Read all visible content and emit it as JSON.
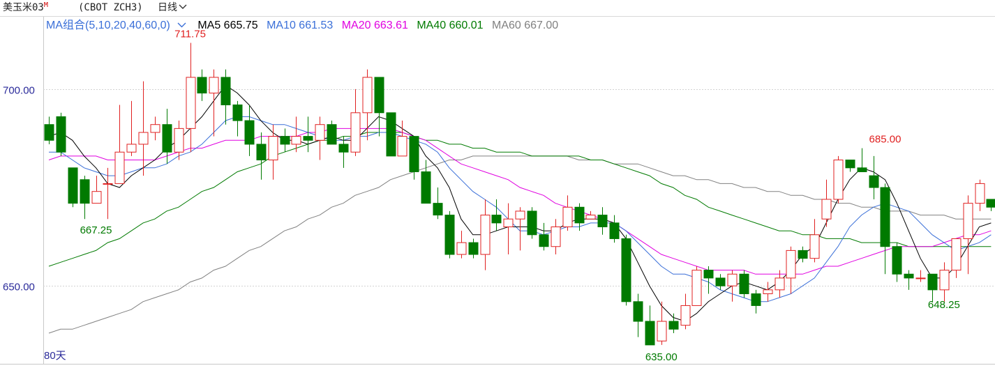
{
  "header": {
    "instrument": "美玉米03",
    "marker": "M",
    "code": "(CBOT ZCH3)",
    "period": "日线",
    "period_icon": "chevron-down-icon"
  },
  "ma_legend": {
    "group_label": "MA组合(5,10,20,40,60,0)",
    "group_icon": "chevron-down-icon",
    "items": [
      {
        "label": "MA5 665.75",
        "color": "#000000"
      },
      {
        "label": "MA10 661.53",
        "color": "#3a6fd8"
      },
      {
        "label": "MA20 663.61",
        "color": "#e000e0"
      },
      {
        "label": "MA40 660.01",
        "color": "#007a00"
      },
      {
        "label": "MA60 667.00",
        "color": "#808080"
      }
    ]
  },
  "colors": {
    "up": "#e02020",
    "down": "#007a00",
    "ma5": "#000000",
    "ma10": "#3a6fd8",
    "ma20": "#e000e0",
    "ma40": "#007a00",
    "ma60": "#808080",
    "axis": "#c8c8c8"
  },
  "chart_data": {
    "type": "candlestick",
    "period_label": "80天",
    "y_axis": {
      "ticks": [
        650.0,
        700.0
      ],
      "tick_labels": [
        "650.00",
        "700.00"
      ],
      "range": [
        630.2,
        718.4
      ]
    },
    "annotations": [
      {
        "text": "711.75",
        "value": 711.75,
        "bar": 12,
        "color": "#e02020",
        "position": "above"
      },
      {
        "text": "667.25",
        "value": 667.25,
        "bar": 4,
        "color": "#007a00",
        "position": "below"
      },
      {
        "text": "685.00",
        "value": 685.0,
        "bar": 71,
        "color": "#e02020",
        "position": "above"
      },
      {
        "text": "635.00",
        "value": 635.0,
        "bar": 52,
        "color": "#007a00",
        "position": "below"
      },
      {
        "text": "648.25",
        "value": 648.25,
        "bar": 76,
        "color": "#007a00",
        "position": "below"
      }
    ],
    "candles": [
      [
        691,
        687,
        693,
        686
      ],
      [
        693,
        684,
        694,
        683
      ],
      [
        680,
        671,
        680,
        670
      ],
      [
        677,
        671,
        678,
        667
      ],
      [
        671,
        674,
        678,
        673
      ],
      [
        676,
        676,
        680,
        667
      ],
      [
        676,
        684,
        696,
        676
      ],
      [
        684,
        686,
        697,
        683
      ],
      [
        686,
        689,
        702,
        678
      ],
      [
        689,
        691,
        693,
        687
      ],
      [
        691,
        684,
        695,
        681
      ],
      [
        684,
        690,
        692,
        682
      ],
      [
        690,
        703,
        711.75,
        684
      ],
      [
        703,
        699,
        705,
        697
      ],
      [
        699,
        703,
        705,
        688
      ],
      [
        703,
        696,
        705,
        691
      ],
      [
        696,
        692,
        697,
        688
      ],
      [
        692,
        686,
        696,
        683
      ],
      [
        686,
        682,
        689,
        677
      ],
      [
        682,
        688,
        691,
        677
      ],
      [
        688,
        686,
        690,
        684
      ],
      [
        686,
        688,
        693,
        684
      ],
      [
        688,
        687,
        693,
        684
      ],
      [
        687,
        691,
        693,
        682
      ],
      [
        691,
        686,
        692,
        686
      ],
      [
        686,
        684,
        688,
        680
      ],
      [
        684,
        694,
        700,
        683
      ],
      [
        694,
        703,
        705,
        687
      ],
      [
        703,
        694,
        703,
        688
      ],
      [
        694,
        683,
        694,
        683
      ],
      [
        683,
        688,
        692,
        683
      ],
      [
        688,
        679,
        682,
        677
      ],
      [
        679,
        671,
        682,
        671
      ],
      [
        671,
        668,
        675,
        667
      ],
      [
        668,
        658,
        669,
        657
      ],
      [
        658,
        661,
        664,
        657
      ],
      [
        661,
        658,
        662,
        657
      ],
      [
        658,
        668,
        672,
        654
      ],
      [
        668,
        666,
        672,
        664
      ],
      [
        665,
        667,
        671,
        658
      ],
      [
        667,
        669,
        670,
        659
      ],
      [
        669,
        663,
        670,
        662
      ],
      [
        663,
        660,
        666,
        659
      ],
      [
        660,
        665,
        667,
        658
      ],
      [
        665,
        670,
        673,
        664
      ],
      [
        670,
        666,
        671,
        664
      ],
      [
        667,
        668,
        669,
        668
      ],
      [
        668,
        665,
        670,
        663
      ],
      [
        666,
        662,
        668,
        661
      ],
      [
        662,
        646,
        663,
        645
      ],
      [
        646,
        641,
        648,
        637
      ],
      [
        641,
        635,
        645,
        635
      ],
      [
        636,
        641,
        646,
        635
      ],
      [
        641,
        639,
        643,
        638
      ],
      [
        640,
        645,
        648,
        639
      ],
      [
        645,
        654,
        655,
        645
      ],
      [
        654,
        652,
        655,
        648
      ],
      [
        652,
        650,
        653,
        649
      ],
      [
        650,
        653,
        654,
        646
      ],
      [
        653,
        648,
        654,
        647
      ],
      [
        648,
        645,
        649,
        643
      ],
      [
        648,
        649,
        651,
        646
      ],
      [
        649,
        652,
        654,
        647
      ],
      [
        652,
        659,
        660,
        648
      ],
      [
        659,
        657,
        660,
        656
      ],
      [
        657,
        663,
        667,
        656
      ],
      [
        667,
        672,
        677,
        665
      ],
      [
        672,
        682,
        683,
        671
      ],
      [
        682,
        680,
        681,
        679
      ],
      [
        680,
        679,
        685,
        679
      ],
      [
        678,
        675,
        683,
        672
      ],
      [
        675,
        660,
        676,
        653
      ],
      [
        660,
        653,
        661,
        651
      ],
      [
        653,
        652,
        654,
        649
      ],
      [
        652,
        652,
        654,
        651
      ],
      [
        653,
        649,
        653,
        646
      ],
      [
        649,
        654,
        656,
        646
      ],
      [
        654,
        662,
        662,
        652
      ],
      [
        662,
        671,
        673,
        653
      ],
      [
        671,
        676,
        677,
        669
      ],
      [
        672,
        670,
        672,
        669
      ]
    ],
    "ma5": [
      688,
      689,
      687,
      683,
      680,
      676,
      675,
      678,
      680,
      682,
      685,
      687,
      690,
      693,
      697,
      701,
      699,
      696,
      692,
      689,
      687,
      687,
      686,
      687,
      688,
      687,
      687,
      690,
      693,
      692,
      690,
      688,
      683,
      680,
      675,
      667,
      663,
      663,
      664,
      665,
      665,
      665,
      664,
      664,
      666,
      667,
      667,
      667,
      666,
      662,
      656,
      650,
      645,
      642,
      641,
      643,
      646,
      648,
      650,
      651,
      650,
      649,
      651,
      654,
      658,
      660,
      666,
      672,
      677,
      680,
      679,
      677,
      671,
      664,
      657,
      652,
      652,
      655,
      660,
      665,
      666
    ],
    "ma10": [
      684,
      684,
      682,
      680,
      679,
      678,
      678,
      679,
      680,
      680,
      681,
      683,
      684,
      686,
      689,
      692,
      693,
      693,
      692,
      691,
      691,
      690,
      689,
      688,
      687,
      687,
      688,
      688,
      689,
      689,
      688,
      687,
      686,
      684,
      680,
      677,
      674,
      672,
      670,
      667,
      664,
      664,
      663,
      664,
      665,
      665,
      666,
      666,
      666,
      664,
      661,
      658,
      655,
      653,
      653,
      652,
      651,
      649,
      648,
      647,
      646,
      646,
      647,
      648,
      650,
      652,
      656,
      660,
      665,
      668,
      670,
      671,
      670,
      669,
      666,
      663,
      661,
      659,
      660,
      661,
      663
    ],
    "ma20": [
      682,
      683,
      683,
      683,
      683,
      682,
      682,
      682,
      682,
      682,
      683,
      684,
      685,
      685,
      686,
      687,
      687,
      687,
      688,
      688,
      688,
      688,
      689,
      689,
      690,
      690,
      690,
      690,
      690,
      690,
      689,
      688,
      687,
      685,
      683,
      681,
      680,
      679,
      678,
      677,
      675,
      674,
      673,
      671,
      670,
      669,
      668,
      667,
      666,
      664,
      662,
      660,
      658,
      657,
      656,
      655,
      654,
      654,
      654,
      654,
      653,
      653,
      653,
      653,
      653,
      654,
      655,
      655,
      656,
      657,
      658,
      659,
      660,
      660,
      660,
      660,
      661,
      662,
      663,
      663,
      664
    ],
    "ma40": [
      655,
      656,
      657,
      658,
      659,
      661,
      662,
      664,
      666,
      667,
      669,
      670,
      672,
      674,
      675,
      677,
      679,
      680,
      681,
      683,
      684,
      685,
      686,
      687,
      687,
      688,
      688,
      689,
      689,
      689,
      689,
      688,
      687,
      687,
      686,
      686,
      685,
      685,
      684,
      684,
      684,
      683,
      683,
      683,
      683,
      683,
      682,
      682,
      681,
      680,
      679,
      678,
      676,
      675,
      673,
      672,
      670,
      669,
      668,
      667,
      666,
      665,
      664,
      664,
      663,
      663,
      662,
      662,
      662,
      661,
      661,
      661,
      661,
      660,
      660,
      660,
      660,
      660,
      660,
      660,
      660
    ],
    "ma60": [
      638,
      639,
      639,
      640,
      641,
      642,
      643,
      644,
      646,
      647,
      648,
      649,
      651,
      652,
      654,
      655,
      657,
      659,
      660,
      662,
      664,
      665,
      667,
      668,
      670,
      671,
      673,
      674,
      675,
      677,
      678,
      679,
      680,
      681,
      682,
      682,
      683,
      683,
      683,
      683,
      683,
      683,
      683,
      683,
      683,
      682,
      682,
      682,
      681,
      681,
      681,
      680,
      679,
      678,
      678,
      677,
      677,
      676,
      676,
      675,
      675,
      674,
      674,
      673,
      673,
      672,
      672,
      671,
      671,
      670,
      670,
      669,
      669,
      669,
      668,
      668,
      668,
      667,
      667,
      667,
      667
    ]
  }
}
